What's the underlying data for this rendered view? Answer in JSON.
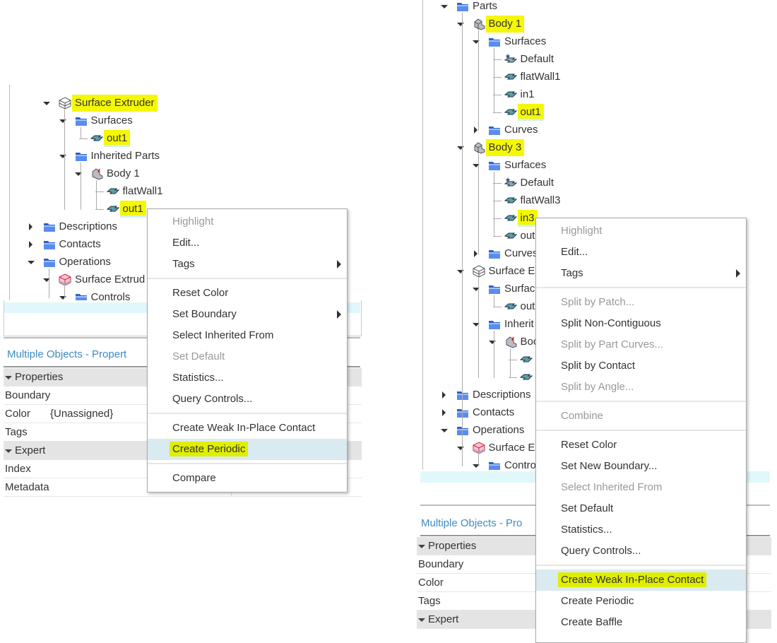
{
  "colors": {
    "highlight_marker": "#f4f800",
    "menu_hover": "#d9eaf1",
    "folder": "#3b6fd8",
    "title": "#3d8bbf"
  },
  "left": {
    "tree": [
      {
        "label": "Surface Extruder",
        "icon": "extruder-part-icon",
        "exp": "open",
        "hl": true,
        "children": [
          {
            "label": "Surfaces",
            "icon": "folder-icon",
            "exp": "open",
            "children": [
              {
                "label": "out1",
                "icon": "surface-icon",
                "hl": true,
                "sel": true
              }
            ]
          },
          {
            "label": "Inherited Parts",
            "icon": "folder-icon",
            "exp": "open",
            "children": [
              {
                "label": "Body 1",
                "icon": "cad-body-icon",
                "exp": "open",
                "children": [
                  {
                    "label": "flatWall1",
                    "icon": "surface-icon"
                  },
                  {
                    "label": "out1",
                    "icon": "surface-icon",
                    "hl": true,
                    "sel": true
                  }
                ]
              }
            ]
          }
        ]
      },
      {
        "label": "Descriptions",
        "icon": "folder-icon",
        "exp": "closed",
        "root": true
      },
      {
        "label": "Contacts",
        "icon": "folder-icon",
        "exp": "closed",
        "root": true
      },
      {
        "label": "Operations",
        "icon": "folder-icon",
        "exp": "open",
        "root": true,
        "children": [
          {
            "label": "Surface Extrud",
            "icon": "operation-icon",
            "exp": "open",
            "children": [
              {
                "label": "Controls",
                "icon": "folder-icon",
                "exp": "open"
              }
            ]
          }
        ]
      }
    ],
    "properties_title": "Multiple Objects - Propert",
    "properties": [
      {
        "label": "Properties",
        "header": true
      },
      {
        "label": "Boundary"
      },
      {
        "label": "Color",
        "value": "{Unassigned}"
      },
      {
        "label": "Tags"
      },
      {
        "label": "Expert",
        "header": true
      },
      {
        "label": "Index"
      },
      {
        "label": "Metadata"
      }
    ],
    "menu": [
      {
        "label": "Highlight",
        "disabled": true
      },
      {
        "label": "Edit..."
      },
      {
        "label": "Tags",
        "submenu": true
      },
      {
        "sep": true
      },
      {
        "label": "Reset Color"
      },
      {
        "label": "Set Boundary",
        "submenu": true
      },
      {
        "label": "Select Inherited From"
      },
      {
        "label": "Set Default",
        "disabled": true
      },
      {
        "label": "Statistics..."
      },
      {
        "label": "Query Controls..."
      },
      {
        "sep": true
      },
      {
        "label": "Create Weak In-Place Contact"
      },
      {
        "label": "Create Periodic",
        "hover": true,
        "hl": true
      },
      {
        "sep": true
      },
      {
        "label": "Compare"
      }
    ]
  },
  "right": {
    "tree": [
      {
        "label": "Parts",
        "icon": "folder-icon",
        "exp": "open",
        "children": [
          {
            "label": "Body 1",
            "icon": "part-icon",
            "exp": "open",
            "hl": true,
            "children": [
              {
                "label": "Surfaces",
                "icon": "folder-icon",
                "exp": "open",
                "children": [
                  {
                    "label": "Default",
                    "icon": "default-surface-icon"
                  },
                  {
                    "label": "flatWall1",
                    "icon": "surface-icon"
                  },
                  {
                    "label": "in1",
                    "icon": "surface-icon"
                  },
                  {
                    "label": "out1",
                    "icon": "surface-icon",
                    "hl": true,
                    "sel": true
                  }
                ]
              },
              {
                "label": "Curves",
                "icon": "folder-icon",
                "exp": "closed"
              }
            ]
          },
          {
            "label": "Body 3",
            "icon": "part-icon",
            "exp": "open",
            "hl": true,
            "children": [
              {
                "label": "Surfaces",
                "icon": "folder-icon",
                "exp": "open",
                "children": [
                  {
                    "label": "Default",
                    "icon": "default-surface-icon"
                  },
                  {
                    "label": "flatWall3",
                    "icon": "surface-icon"
                  },
                  {
                    "label": "in3",
                    "icon": "surface-icon",
                    "hl": true,
                    "sel": true
                  },
                  {
                    "label": "out",
                    "icon": "surface-icon"
                  }
                ]
              },
              {
                "label": "Curves",
                "icon": "folder-icon",
                "exp": "closed"
              }
            ]
          },
          {
            "label": "Surface E",
            "icon": "extruder-part-icon",
            "exp": "open",
            "children": [
              {
                "label": "Surfac",
                "icon": "folder-icon",
                "exp": "open",
                "children": [
                  {
                    "label": "out",
                    "icon": "surface-icon"
                  }
                ]
              },
              {
                "label": "Inherit",
                "icon": "folder-icon",
                "exp": "open",
                "children": [
                  {
                    "label": "Boc",
                    "icon": "cad-body-icon",
                    "exp": "open",
                    "children": [
                      {
                        "label": "",
                        "icon": "surface-icon"
                      },
                      {
                        "label": "",
                        "icon": "surface-icon"
                      }
                    ]
                  }
                ]
              }
            ]
          },
          {
            "label": "Descriptions",
            "icon": "folder-icon",
            "exp": "closed",
            "up": true
          },
          {
            "label": "Contacts",
            "icon": "folder-icon",
            "exp": "closed",
            "up": true
          },
          {
            "label": "Operations",
            "icon": "folder-icon",
            "exp": "open",
            "up": true,
            "children": [
              {
                "label": "Surface E",
                "icon": "operation-icon",
                "exp": "open",
                "children": [
                  {
                    "label": "Contro",
                    "icon": "folder-icon",
                    "exp": "open"
                  }
                ]
              }
            ]
          }
        ]
      }
    ],
    "properties_title": "Multiple Objects - Pro",
    "properties": [
      {
        "label": "Properties",
        "header": true
      },
      {
        "label": "Boundary"
      },
      {
        "label": "Color"
      },
      {
        "label": "Tags"
      },
      {
        "label": "Expert",
        "header": true
      }
    ],
    "menu": [
      {
        "label": "Highlight",
        "disabled": true
      },
      {
        "label": "Edit..."
      },
      {
        "label": "Tags",
        "submenu": true
      },
      {
        "sep": true
      },
      {
        "label": "Split by Patch...",
        "disabled": true
      },
      {
        "label": "Split Non-Contiguous"
      },
      {
        "label": "Split by Part Curves...",
        "disabled": true
      },
      {
        "label": "Split by Contact"
      },
      {
        "label": "Split by Angle...",
        "disabled": true
      },
      {
        "sep": true
      },
      {
        "label": "Combine",
        "disabled": true
      },
      {
        "sep": true
      },
      {
        "label": "Reset Color"
      },
      {
        "label": "Set New Boundary..."
      },
      {
        "label": "Select Inherited From",
        "disabled": true
      },
      {
        "label": "Set Default"
      },
      {
        "label": "Statistics..."
      },
      {
        "label": "Query Controls..."
      },
      {
        "sep": true
      },
      {
        "label": "Create Weak In-Place Contact",
        "hover": true,
        "hl": true
      },
      {
        "label": "Create Periodic"
      },
      {
        "label": "Create Baffle"
      }
    ]
  }
}
